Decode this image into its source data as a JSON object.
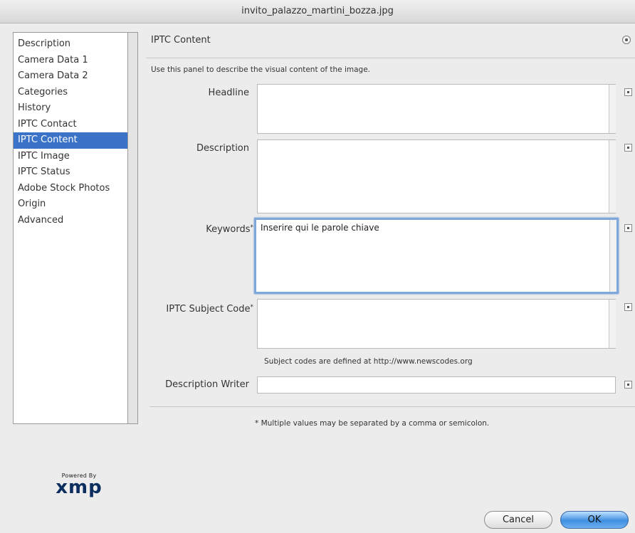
{
  "window": {
    "title": "invito_palazzo_martini_bozza.jpg"
  },
  "sidebar": {
    "items": [
      {
        "label": "Description"
      },
      {
        "label": "Camera Data 1"
      },
      {
        "label": "Camera Data 2"
      },
      {
        "label": "Categories"
      },
      {
        "label": "History"
      },
      {
        "label": "IPTC Contact"
      },
      {
        "label": "IPTC Content",
        "selected": true
      },
      {
        "label": "IPTC Image"
      },
      {
        "label": "IPTC Status"
      },
      {
        "label": "Adobe Stock Photos"
      },
      {
        "label": "Origin"
      },
      {
        "label": "Advanced"
      }
    ]
  },
  "panel": {
    "title": "IPTC Content",
    "description": "Use this panel to describe the visual content of the image.",
    "fields": {
      "headline": {
        "label": "Headline",
        "value": ""
      },
      "description": {
        "label": "Description",
        "value": ""
      },
      "keywords": {
        "label": "Keywords",
        "marker": "*",
        "value": "Inserire qui le parole chiave"
      },
      "subject_code": {
        "label": "IPTC Subject Code",
        "marker": "*",
        "value": "",
        "hint": "Subject codes are defined at http://www.newscodes.org"
      },
      "description_writer": {
        "label": "Description Writer",
        "value": ""
      }
    },
    "footnote": "* Multiple values may be separated by a comma or semicolon."
  },
  "logo": {
    "small": "Powered By",
    "big": "xmp"
  },
  "buttons": {
    "cancel": "Cancel",
    "ok": "OK"
  }
}
